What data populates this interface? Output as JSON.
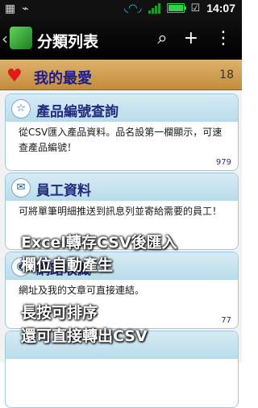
{
  "statusbar": {
    "time": "14:07",
    "usb_icon": "usb-icon",
    "wifi_icon": "wifi-icon",
    "signal_icon": "signal-icon",
    "battery_icon": "battery-icon"
  },
  "appbar": {
    "title": "分類列表",
    "back_icon": "back-chevron-icon",
    "actions": [
      "search-icon",
      "add-icon",
      "more-icon"
    ]
  },
  "favorites": {
    "label": "我的最愛",
    "count": "18"
  },
  "cards": [
    {
      "title": "產品編號查詢",
      "desc": "從CSV匯入產品資料。品名設第一欄顯示，可速查產品編號！",
      "count": "979",
      "icon": "star-icon"
    },
    {
      "title": "員工資料",
      "desc": "可將單筆明細推送到訊息列並寄給需要的員工！",
      "count": "",
      "icon": "mail-icon"
    },
    {
      "title": "網路收藏",
      "desc": "網址及我的文章可直接連結。",
      "count": "77",
      "icon": "globe-icon"
    }
  ],
  "overlay": {
    "line1": "Excel轉存CSV後匯入",
    "line2": "欄位自動產生",
    "line3": "長按可排序",
    "line4": "還可直接轉出CSV"
  }
}
